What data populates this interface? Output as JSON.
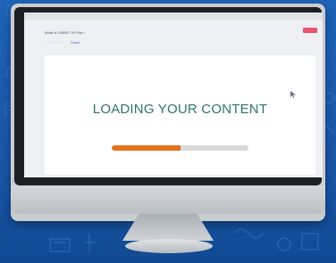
{
  "course": {
    "title": "What is CAREC 90 Part I",
    "rating_stars": [
      "☆",
      "☆",
      "☆",
      "☆",
      "☆"
    ],
    "share_label": "Share"
  },
  "loading": {
    "message": "LOADING YOUR CONTENT",
    "progress_percent": 50
  },
  "colors": {
    "background": "#1f63b8",
    "message_text": "#2f7567",
    "progress_fill": "#e4721e",
    "progress_track": "#d8d8d8",
    "badge": "#e9536b"
  },
  "icons": [
    "star-icon",
    "share-icon",
    "mouse-cursor-icon"
  ]
}
